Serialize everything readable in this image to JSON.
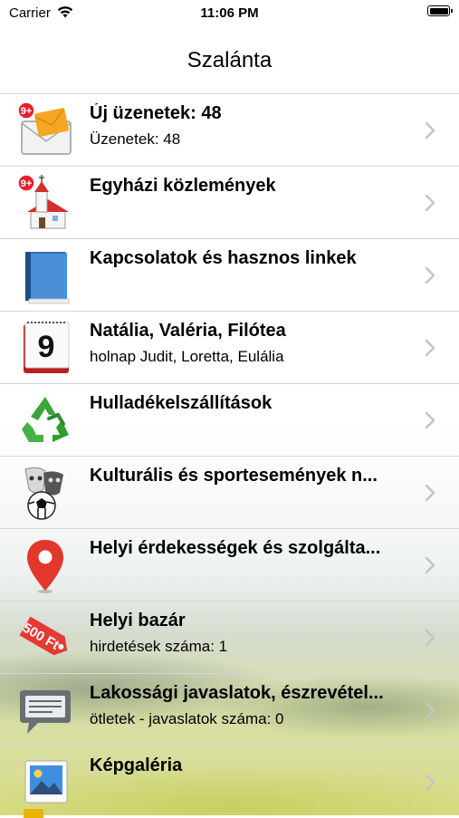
{
  "status_bar": {
    "carrier": "Carrier",
    "time": "11:06 PM"
  },
  "nav": {
    "title": "Szalánta"
  },
  "items": [
    {
      "icon": "mail-envelope-icon",
      "badge": "9+",
      "title": "Új üzenetek: 48",
      "subtitle": "Üzenetek: 48"
    },
    {
      "icon": "church-icon",
      "badge": "9+",
      "title": "Egyházi közlemények",
      "subtitle": ""
    },
    {
      "icon": "address-book-icon",
      "title": "Kapcsolatok és hasznos linkek",
      "subtitle": ""
    },
    {
      "icon": "calendar-icon",
      "calendar_day": "9",
      "title": "Natália, Valéria, Filótea",
      "subtitle": "holnap Judit, Loretta, Eulália"
    },
    {
      "icon": "recycle-icon",
      "title": "Hulladékelszállítások",
      "subtitle": ""
    },
    {
      "icon": "culture-sport-icon",
      "title": "Kulturális és sportesemények n...",
      "subtitle": ""
    },
    {
      "icon": "map-pin-icon",
      "title": "Helyi érdekességek és szolgálta...",
      "subtitle": ""
    },
    {
      "icon": "price-tag-icon",
      "tag_text": "500 Ft",
      "title": "Helyi bazár",
      "subtitle": "hirdetések száma: 1"
    },
    {
      "icon": "speech-bubble-icon",
      "title": "Lakossági javaslatok, észrevétel...",
      "subtitle": "ötletek - javaslatok száma: 0"
    },
    {
      "icon": "photo-gallery-icon",
      "title": "Képgaléria",
      "subtitle": ""
    }
  ],
  "colors": {
    "separator": "#d6d6d6",
    "chevron": "#c4c4c7",
    "badge": "#e0242c",
    "accent_green": "#2f9e2f",
    "pin_red": "#e2372b"
  }
}
